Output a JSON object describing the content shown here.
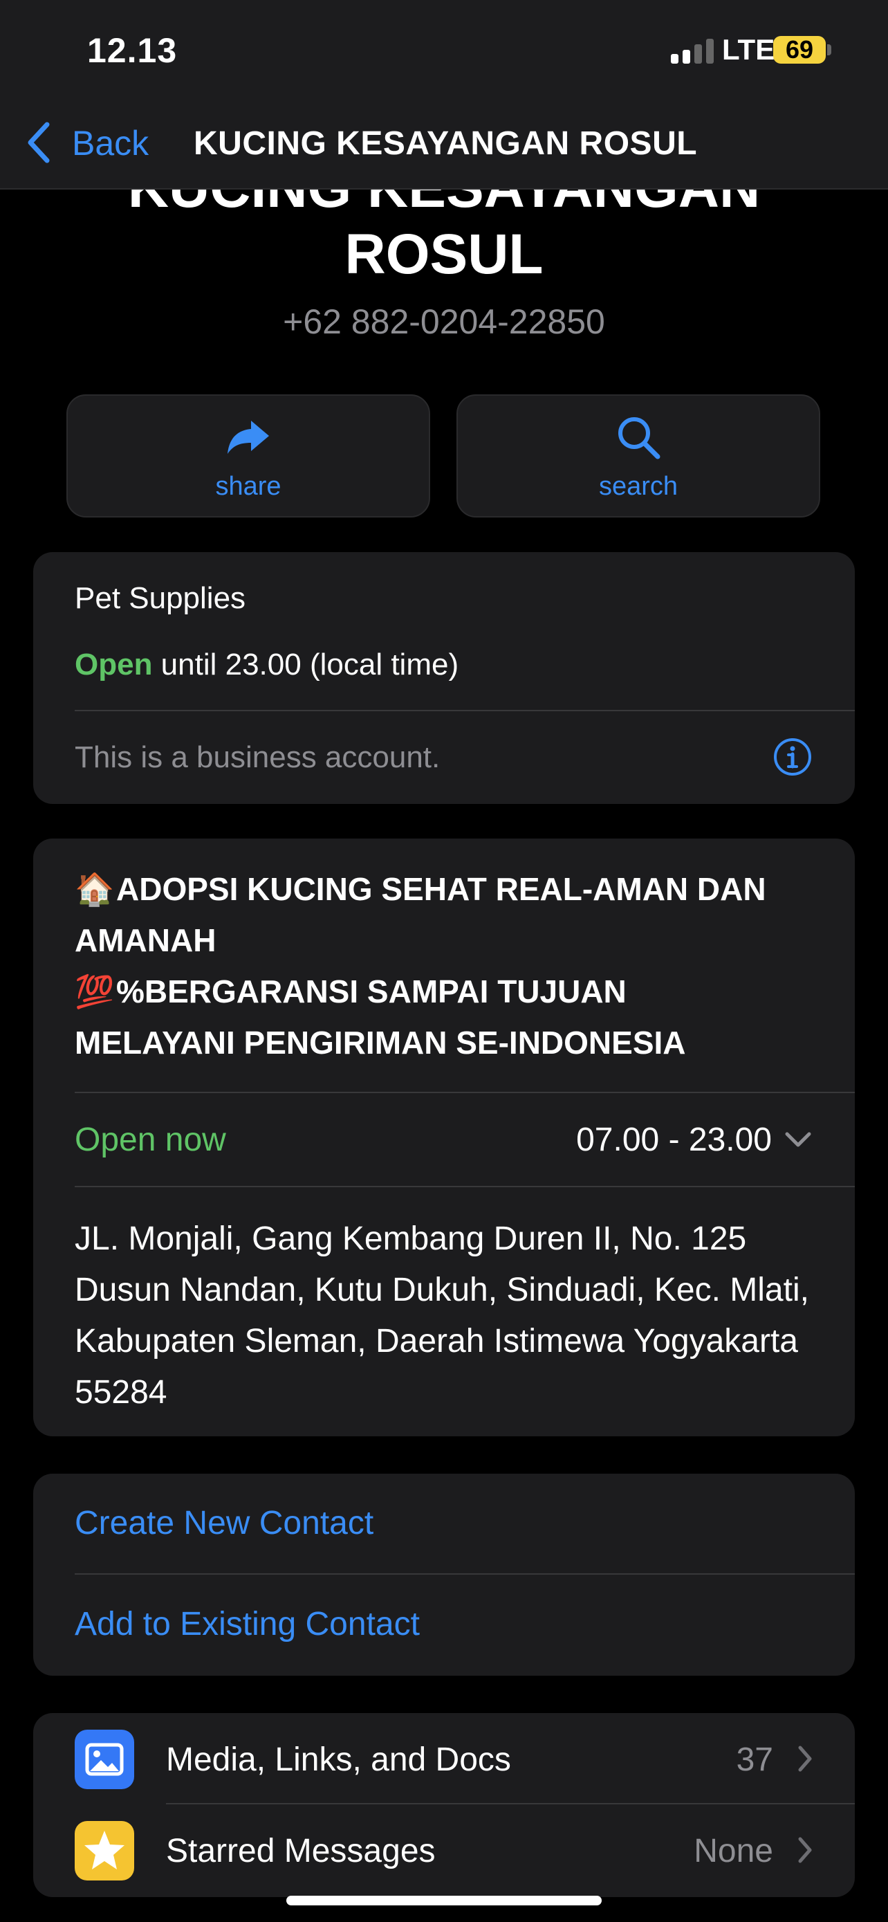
{
  "status_bar": {
    "time": "12.13",
    "network": "LTE",
    "battery": "69"
  },
  "nav": {
    "back_label": "Back",
    "title": "KUCING KESAYANGAN ROSUL"
  },
  "header": {
    "name_line1": "KUCING KESAYANGAN",
    "name_line2": "ROSUL",
    "phone": "+62 882-0204-22850"
  },
  "actions": [
    {
      "label": "share",
      "icon": "share-arrow-icon"
    },
    {
      "label": "search",
      "icon": "search-icon"
    }
  ],
  "business": {
    "category": "Pet Supplies",
    "open_word": "Open",
    "open_until": " until 23.00 (local time)",
    "account_note": "This is a business account.",
    "info_icon": "info-circle-icon"
  },
  "about": {
    "line1_emoji": "🏠",
    "line1": "ADOPSI KUCING SEHAT REAL-AMAN DAN",
    "line2": "AMANAH",
    "line3_emoji": "💯",
    "line3": "%BERGARANSI SAMPAI TUJUAN",
    "line4": "MELAYANI PENGIRIMAN SE-INDONESIA",
    "open_now": "Open now",
    "hours": "07.00 - 23.00",
    "address": "JL. Monjali, Gang Kembang Duren II, No. 125 Dusun Nandan, Kutu Dukuh, Sinduadi, Kec. Mlati, Kabupaten Sleman, Daerah Istimewa Yogyakarta 55284"
  },
  "contact_actions": {
    "create": "Create New Contact",
    "add_existing": "Add to Existing Contact"
  },
  "list": [
    {
      "label": "Media, Links, and Docs",
      "value": "37",
      "icon": "photo-icon",
      "color": "#3478f6"
    },
    {
      "label": "Starred Messages",
      "value": "None",
      "icon": "star-icon",
      "color": "#f5c431"
    }
  ],
  "colors": {
    "accent": "#3a8df5",
    "open_green": "#5fc466",
    "card_bg": "#1c1c1e"
  }
}
